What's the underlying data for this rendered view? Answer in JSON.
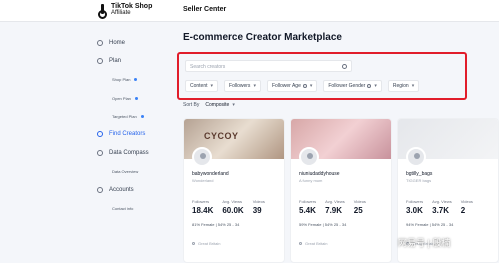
{
  "brand": {
    "line1": "TikTok Shop",
    "line2": "Affiliate"
  },
  "header": {
    "title": "Seller Center"
  },
  "sidebar": {
    "home": "Home",
    "plan": "Plan",
    "plan_items": [
      "Shop Plan",
      "Open Plan",
      "Targeted Plan"
    ],
    "find_creators": "Find Creators",
    "data_compass": "Data Compass",
    "data_items": [
      "Data Overview"
    ],
    "accounts": "Accounts",
    "account_items": [
      "Contact info"
    ]
  },
  "main": {
    "title": "E-commerce Creator Marketplace",
    "search_placeholder": "Search creators",
    "filters": [
      "Content",
      "Followers",
      "Follower Age",
      "Follower Gender",
      "Region"
    ],
    "sort_label": "Sort By",
    "sort_value": "Composite"
  },
  "cards": [
    {
      "banner_text": "CYCOY",
      "name": "babywonderland",
      "sub": "Wonderland",
      "stats": [
        {
          "label": "Followers",
          "value": "18.4K"
        },
        {
          "label": "Avg. Views",
          "value": "60.0K"
        },
        {
          "label": "Videos",
          "value": "39"
        }
      ],
      "demo": "81% Female  |  54% 25 - 34",
      "location": "Great Britain"
    },
    {
      "banner_text": "",
      "name": "niuniudaddyhouse",
      "sub": "A funny mum",
      "stats": [
        {
          "label": "Followers",
          "value": "5.4K"
        },
        {
          "label": "Avg. Views",
          "value": "7.9K"
        },
        {
          "label": "Videos",
          "value": "25"
        }
      ],
      "demo": "59% Female  |  54% 25 - 34",
      "location": "Great Britain"
    },
    {
      "banner_text": "",
      "name": "bgtilly_bags",
      "sub": "TIGGER bags",
      "stats": [
        {
          "label": "Followers",
          "value": "3.0K"
        },
        {
          "label": "Avg. Views",
          "value": "3.7K"
        },
        {
          "label": "Videos",
          "value": "2"
        }
      ],
      "demo": "94% Female  |  54% 25 - 34",
      "location": "Great Britain"
    }
  ],
  "watermark": "网易号 | 殷楠",
  "colors": {
    "accent": "#2563eb",
    "highlight": "#e11d2a"
  }
}
